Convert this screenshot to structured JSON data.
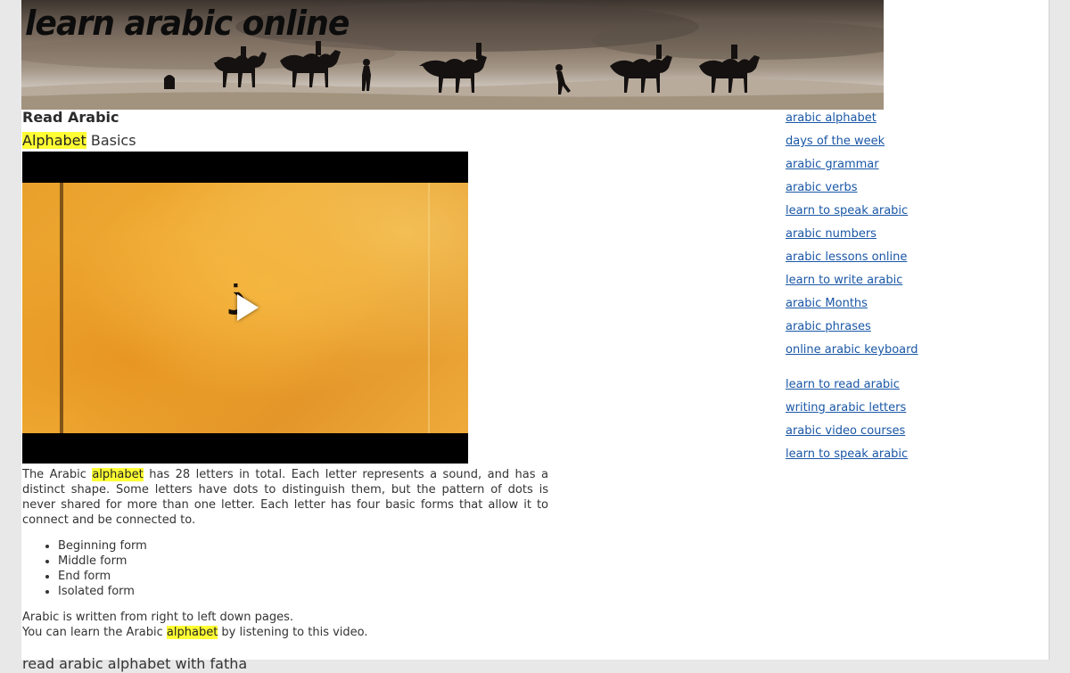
{
  "header": {
    "site_title": "learn arabic online"
  },
  "main": {
    "page_heading": "Read Arabic",
    "sub_heading_highlight": "Alphabet",
    "sub_heading_rest": " Basics",
    "video": {
      "letter": "ذ"
    },
    "paragraph_1": {
      "before": "The Arabic ",
      "highlight": "alphabet",
      "after": " has 28 letters in total. Each letter represents a sound, and has a distinct shape. Some letters have dots to distinguish them, but the pattern of dots is never shared for more than one letter. Each letter has four basic forms that allow it to connect and be connected to."
    },
    "forms": [
      "Beginning form",
      "Middle form",
      "End form",
      "Isolated form"
    ],
    "closing_line_1": "Arabic is written from right to left down pages.",
    "closing_line_2": {
      "before": "You can learn the Arabic ",
      "highlight": "alphabet",
      "after": " by listening to this video."
    },
    "next_heading": "read arabic alphabet with fatha"
  },
  "sidebar": {
    "links_group_1": [
      "arabic alphabet",
      "days of the week",
      "arabic grammar",
      "arabic verbs",
      "learn to speak arabic",
      "arabic numbers",
      "arabic lessons online",
      "learn to write arabic",
      "arabic Months",
      "arabic phrases",
      "online arabic keyboard"
    ],
    "links_group_2": [
      "learn to read arabic",
      "writing arabic letters",
      "arabic video courses",
      "learn to speak arabic"
    ]
  },
  "colors": {
    "link": "#1a57a6",
    "highlight": "#ffff33",
    "background": "#e8e8e8"
  },
  "icons": {
    "play": "play-icon"
  }
}
